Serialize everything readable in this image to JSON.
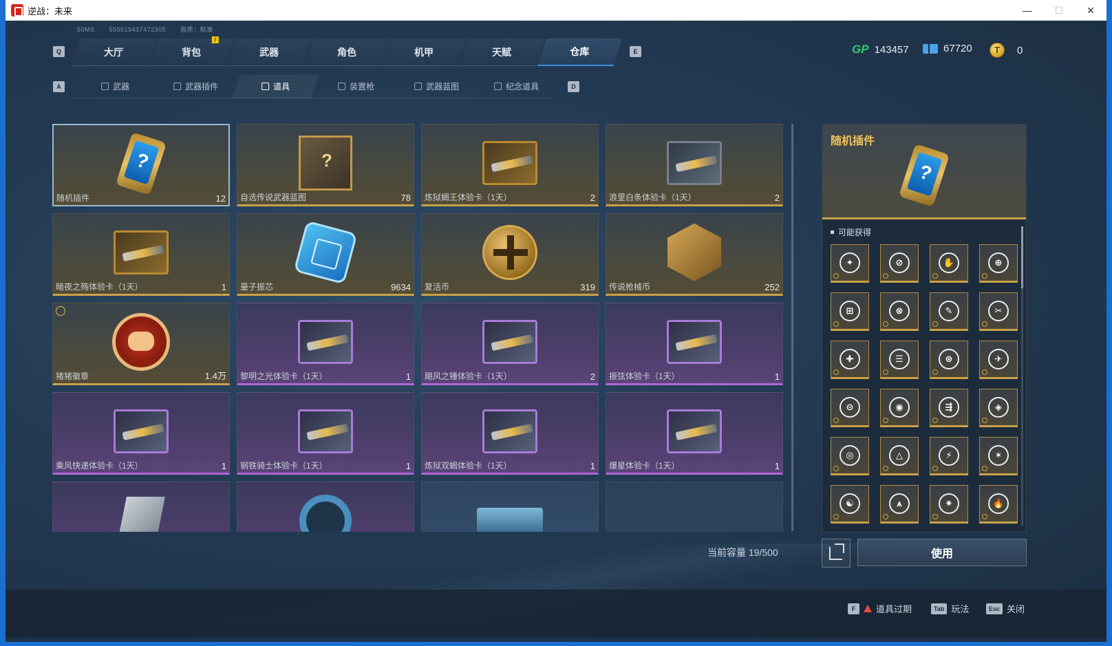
{
  "window": {
    "title": "逆战：未来",
    "min": "—",
    "max": "☐",
    "close": "✕"
  },
  "build_info": {
    "ping": "50MS",
    "id": "550519437472305",
    "quality": "画质：标准"
  },
  "keys": {
    "prev_tab": "Q",
    "next_tab": "E",
    "prev_sub": "A",
    "next_sub": "D"
  },
  "main_tabs": [
    {
      "label": "大厅"
    },
    {
      "label": "背包",
      "alert": "!"
    },
    {
      "label": "武器"
    },
    {
      "label": "角色"
    },
    {
      "label": "机甲"
    },
    {
      "label": "天赋"
    },
    {
      "label": "仓库",
      "active": true
    }
  ],
  "sub_tabs": [
    {
      "label": "武器"
    },
    {
      "label": "武器插件"
    },
    {
      "label": "道具",
      "active": true
    },
    {
      "label": "装置枪"
    },
    {
      "label": "武器蓝图"
    },
    {
      "label": "纪念道具"
    }
  ],
  "currency": {
    "gp": "143457",
    "ticket": "67720",
    "coin": "0",
    "gp_label": "GP"
  },
  "items": [
    {
      "name": "随机插件",
      "count": "12",
      "rarity": "gold",
      "art": "phone",
      "selected": true
    },
    {
      "name": "自选传说武器蓝图",
      "count": "78",
      "rarity": "gold",
      "art": "blueprint"
    },
    {
      "name": "炼狱蝎王体验卡（1天）",
      "count": "2",
      "rarity": "gold",
      "art": "card-gold"
    },
    {
      "name": "浪里白条体验卡（1天）",
      "count": "2",
      "rarity": "gold",
      "art": "card"
    },
    {
      "name": "暗夜之殇体验卡（1天）",
      "count": "1",
      "rarity": "gold",
      "art": "card-gold"
    },
    {
      "name": "量子振芯",
      "count": "9634",
      "rarity": "gold",
      "art": "chip"
    },
    {
      "name": "复活币",
      "count": "319",
      "rarity": "gold",
      "art": "coin"
    },
    {
      "name": "传说枪械币",
      "count": "252",
      "rarity": "gold",
      "art": "hex"
    },
    {
      "name": "猪猪徽章",
      "count": "1.4万",
      "rarity": "gold",
      "art": "pig",
      "timer": true
    },
    {
      "name": "黎明之光体验卡（1天）",
      "count": "1",
      "rarity": "purple",
      "art": "card-purple"
    },
    {
      "name": "飓风之锤体验卡（1天）",
      "count": "2",
      "rarity": "purple",
      "art": "card-purple"
    },
    {
      "name": "振弦体验卡（1天）",
      "count": "1",
      "rarity": "purple",
      "art": "card-purple"
    },
    {
      "name": "乘风快递体验卡（1天）",
      "count": "1",
      "rarity": "purple",
      "art": "card-purple"
    },
    {
      "name": "钢铁骑士体验卡（1天）",
      "count": "1",
      "rarity": "purple",
      "art": "card-purple"
    },
    {
      "name": "炼狱双蝎体验卡（1天）",
      "count": "1",
      "rarity": "purple",
      "art": "card-purple"
    },
    {
      "name": "爆星体验卡（1天）",
      "count": "1",
      "rarity": "purple",
      "art": "card-purple"
    },
    {
      "name": "",
      "count": "",
      "rarity": "purple",
      "art": "badge"
    },
    {
      "name": "",
      "count": "",
      "rarity": "purple",
      "art": "ring"
    },
    {
      "name": "",
      "count": "",
      "rarity": "blue",
      "art": "box"
    },
    {
      "name": "",
      "count": "",
      "rarity": "empty",
      "art": "none"
    }
  ],
  "capacity": "当前容量 19/500",
  "detail": {
    "title": "随机插件",
    "may_get": "可能获得",
    "rewards": [
      "✦",
      "⊘",
      "✋",
      "⊕",
      "⊞",
      "⊗",
      "✎",
      "✂",
      "✚",
      "☰",
      "⊛",
      "✈",
      "⊝",
      "◉",
      "⇶",
      "◈",
      "◎",
      "△",
      "⚡",
      "✶",
      "☯",
      "⩚",
      "✷",
      "🔥"
    ],
    "use_button": "使用"
  },
  "hints": {
    "expire_key": "F",
    "expire_label": "道具过期",
    "rules_key": "Tab",
    "rules_label": "玩法",
    "close_key": "Esc",
    "close_label": "关闭"
  },
  "colors": {
    "accent_blue": "#3d8fe3",
    "gold": "#c9a24a",
    "purple": "#b267d6",
    "title_gold": "#f0c25a"
  }
}
